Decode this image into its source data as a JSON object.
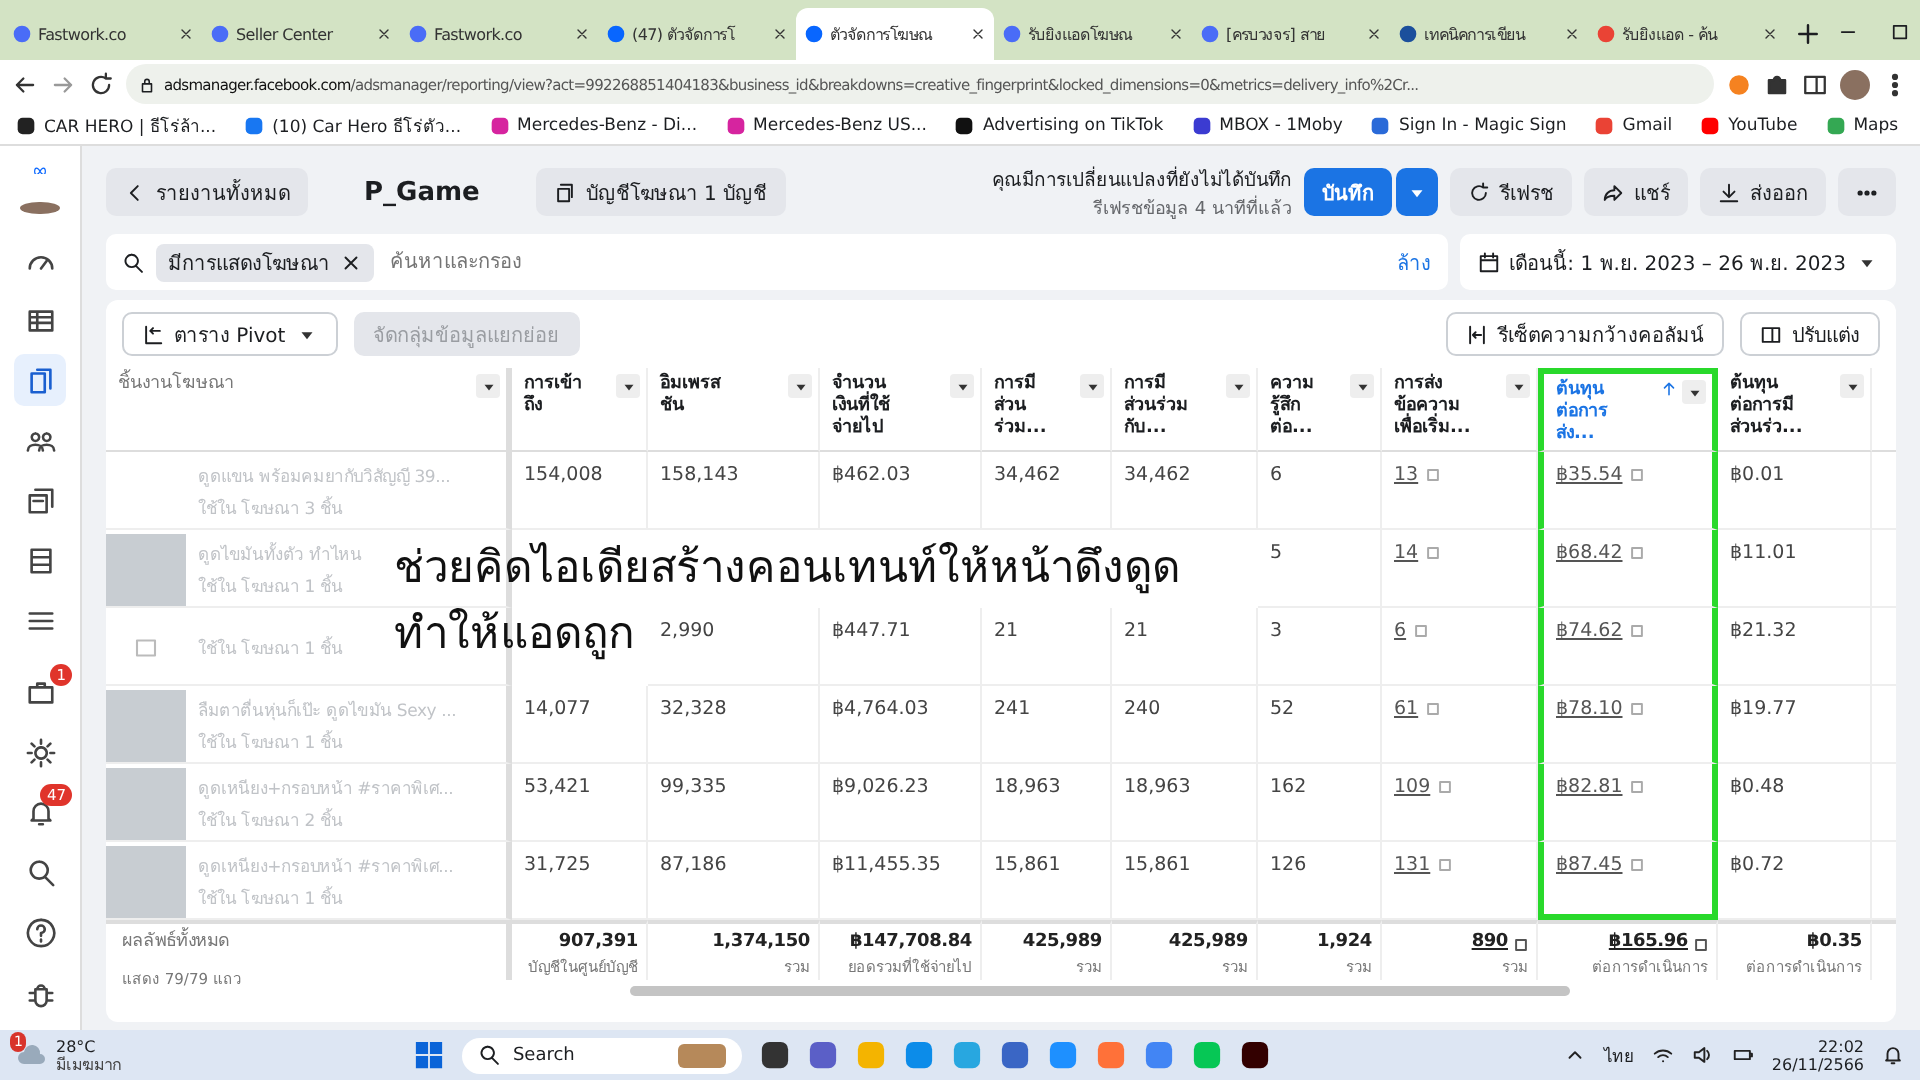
{
  "browser": {
    "tabs": [
      {
        "title": "Fastwork.co",
        "selected": false
      },
      {
        "title": "Seller Center",
        "selected": false
      },
      {
        "title": "Fastwork.co",
        "selected": false
      },
      {
        "title": "(47) ตัวจัดการโ",
        "selected": false
      },
      {
        "title": "ตัวจัดการโฆษณ",
        "selected": true
      },
      {
        "title": "รับยิงแอดโฆษณ",
        "selected": false
      },
      {
        "title": "[ครบวงจร] สาย",
        "selected": false
      },
      {
        "title": "เทคนิคการเขียน",
        "selected": false
      },
      {
        "title": "รับยิงแอด - ค้น",
        "selected": false
      }
    ],
    "url_host": "adsmanager.facebook.com",
    "url_path": "/adsmanager/reporting/view?act=992268851404183&business_id&breakdowns=creative_fingerprint&locked_dimensions=0&metrics=delivery_info%2Cr...",
    "bookmarks": [
      "CAR HERO | ธีโร่ล้า...",
      "(10) Car Hero ธีโร่ตัว...",
      "Mercedes-Benz - Di...",
      "Mercedes-Benz US...",
      "Advertising on TikTok",
      "MBOX - 1Moby",
      "Sign In - Magic Sign",
      "Gmail",
      "YouTube",
      "Maps"
    ]
  },
  "nav": {
    "items": [
      {
        "selected": false
      },
      {
        "selected": false
      },
      {
        "selected": true
      },
      {
        "selected": false
      },
      {
        "selected": false
      },
      {
        "selected": false
      },
      {
        "selected": false
      }
    ],
    "briefcase_badge": "1",
    "bell_badge": "47"
  },
  "header": {
    "back": "รายงานทั้งหมด",
    "title": "P_Game",
    "accounts": "บัญชีโฆษณา 1 บัญชี",
    "notice": "คุณมีการเปลี่ยนแปลงที่ยังไม่ได้บันทึก",
    "refreshed": "รีเฟรชข้อมูล 4 นาทีที่แล้ว",
    "save": "บันทึก",
    "actions": [
      "รีเฟรช",
      "แชร์",
      "ส่งออก"
    ]
  },
  "filter": {
    "chip": "มีการแสดงโฆษณา",
    "placeholder": "ค้นหาและกรอง",
    "clear": "ล้าง",
    "date": "เดือนนี้: 1 พ.ย. 2023 – 26 พ.ย. 2023"
  },
  "toolbar": {
    "left": [
      {
        "label": "ตาราง Pivot",
        "disabled": false
      },
      {
        "label": "จัดกลุ่มข้อมูลแยกย่อย",
        "disabled": true
      }
    ],
    "right": [
      {
        "label": "รีเซ็ตความกว้างคอลัมน์",
        "disabled": false
      },
      {
        "label": "ปรับแต่ง",
        "disabled": false
      }
    ]
  },
  "table": {
    "columns": [
      {
        "label": "ชิ้นงานโฆษณา",
        "kind": "name",
        "sorted": false,
        "annotated": false
      },
      {
        "label": "การเข้า\nถึง",
        "kind": "plain",
        "sorted": false,
        "annotated": false
      },
      {
        "label": "อิมเพรส\nชัน",
        "kind": "plain",
        "sorted": false,
        "annotated": false
      },
      {
        "label": "จำนวน\nเงินที่ใช้\nจ่ายไป",
        "kind": "plain",
        "sorted": false,
        "annotated": false
      },
      {
        "label": "การมี\nส่วน\nร่วม...",
        "kind": "plain",
        "sorted": false,
        "annotated": false
      },
      {
        "label": "การมี\nส่วนร่วม\nกับ...",
        "kind": "plain",
        "sorted": false,
        "annotated": false
      },
      {
        "label": "ความ\nรู้สึก\nต่อ...",
        "kind": "plain",
        "sorted": false,
        "annotated": false
      },
      {
        "label": "การส่ง\nข้อความ\nเพื่อเริ่ม...",
        "kind": "link",
        "sorted": false,
        "annotated": false
      },
      {
        "label": "ต้นทุน\nต่อการ\nส่ง...",
        "kind": "link",
        "sorted": true,
        "annotated": true
      },
      {
        "label": "ต้นทุน\nต่อการมี\nส่วนร่ว...",
        "kind": "plain",
        "sorted": false,
        "annotated": false
      }
    ],
    "rows": [
      {
        "name": "ดูดแขน พร้อมคมยากับวิสัญญี 39...",
        "sub": "ใช้ใน โฆษณา 3 ชิ้น",
        "kind": "text",
        "values": [
          "154,008",
          "158,143",
          "฿462.03",
          "34,462",
          "34,462",
          "6",
          "13",
          "฿35.54",
          "฿0.01"
        ]
      },
      {
        "name": "ดูดไขมันทั้งตัว ทำไหน",
        "sub": "ใช้ใน โฆษณา 1 ชิ้น",
        "kind": "photo",
        "values": [
          "5",
          "14",
          "฿68.42",
          "฿11.01"
        ]
      },
      {
        "sub": "ใช้ใน โฆษณา 1 ชิ้น",
        "kind": "placeholder",
        "values": [
          "2,990",
          "฿447.71",
          "21",
          "21",
          "3",
          "6",
          "฿74.62",
          "฿21.32"
        ]
      },
      {
        "name": "ลืมตาตื่นหุ่นก็เป๊ะ ดูดไขมัน Sexy ...",
        "sub": "ใช้ใน โฆษณา 1 ชิ้น",
        "kind": "photo",
        "values": [
          "14,077",
          "32,328",
          "฿4,764.03",
          "241",
          "240",
          "52",
          "61",
          "฿78.10",
          "฿19.77"
        ]
      },
      {
        "name": "ดูดเหนียง+กรอบหน้า #ราคาพิเศ...",
        "sub": "ใช้ใน โฆษณา 2 ชิ้น",
        "kind": "photo",
        "values": [
          "53,421",
          "99,335",
          "฿9,026.23",
          "18,963",
          "18,963",
          "162",
          "109",
          "฿82.81",
          "฿0.48"
        ]
      },
      {
        "name": "ดูดเหนียง+กรอบหน้า #ราคาพิเศ...",
        "sub": "ใช้ใน โฆษณา 1 ชิ้น",
        "kind": "photo",
        "values": [
          "31,725",
          "87,186",
          "฿11,455.35",
          "15,861",
          "15,861",
          "126",
          "131",
          "฿87.45",
          "฿0.72"
        ]
      }
    ],
    "totals_label": "ผลลัพธ์ทั้งหมด",
    "totals_sub": "แสดง 79/79 แถว",
    "totals": [
      {
        "value": "907,391",
        "label": "บัญชีในศูนย์บัญชี"
      },
      {
        "value": "1,374,150",
        "label": "รวม"
      },
      {
        "value": "฿147,708.84",
        "label": "ยอดรวมที่ใช้จ่ายไป"
      },
      {
        "value": "425,989",
        "label": "รวม"
      },
      {
        "value": "425,989",
        "label": "รวม"
      },
      {
        "value": "1,924",
        "label": "รวม"
      },
      {
        "value": "890",
        "label": "รวม"
      },
      {
        "value": "฿165.96",
        "label": "ต่อการดำเนินการ"
      },
      {
        "value": "฿0.35",
        "label": "ต่อการดำเนินการ"
      }
    ]
  },
  "overlay_caption": [
    "ช่วยคิดไอเดียสร้างคอนเทนท์ให้หน้าดึงดูด",
    "ทำให้แอดถูก"
  ],
  "taskbar": {
    "temp": "28°C",
    "weather": "มีเมฆมาก",
    "weather_badge": "1",
    "search": "Search",
    "lang": "ไทย",
    "time": "22:02",
    "date": "26/11/2566"
  }
}
